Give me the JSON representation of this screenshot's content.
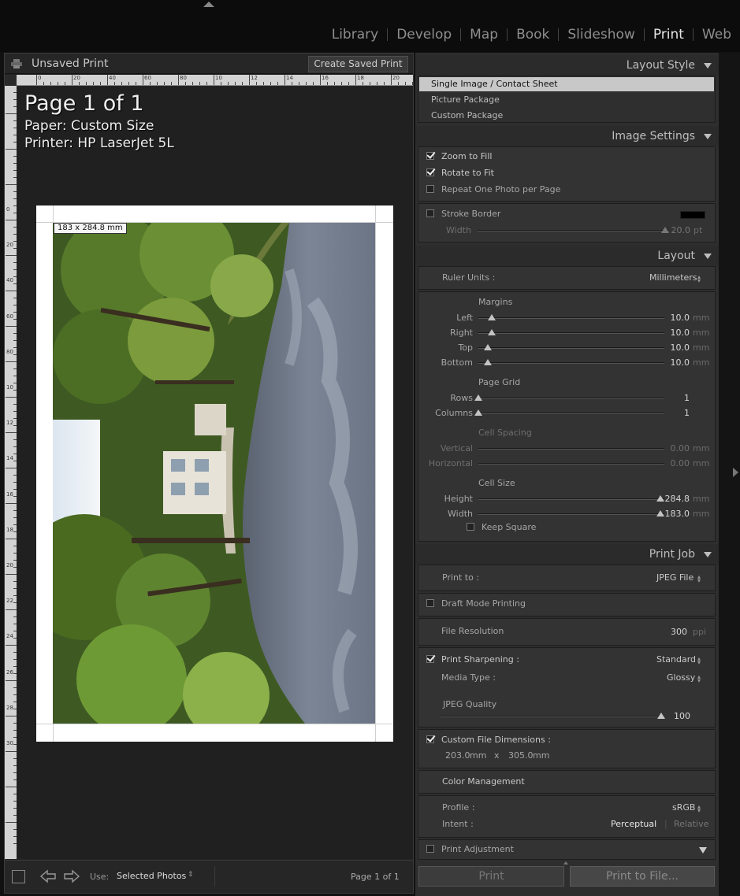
{
  "modules": [
    "Library",
    "Develop",
    "Map",
    "Book",
    "Slideshow",
    "Print",
    "Web"
  ],
  "active_module": "Print",
  "left_header": {
    "title": "Unsaved Print",
    "create_button": "Create Saved Print"
  },
  "page_info": {
    "title": "Page 1 of 1",
    "paper": "Paper:  Custom Size",
    "printer": "Printer:  HP LaserJet 5L"
  },
  "ruler": {
    "h_labels": [
      "0",
      "20",
      "40",
      "60",
      "80",
      "10",
      "12",
      "14",
      "16",
      "18",
      "20"
    ],
    "v_labels": [
      "0",
      "20",
      "40",
      "60",
      "80",
      "10",
      "12",
      "14",
      "16",
      "18",
      "20",
      "22",
      "24",
      "26",
      "28",
      "30"
    ]
  },
  "cell_dimension_label": "183 x 284.8 mm",
  "filmstrip": {
    "use_label": "Use:",
    "use_value": "Selected Photos",
    "page_count": "Page 1 of 1"
  },
  "layout_style": {
    "title": "Layout Style",
    "items": [
      "Single Image / Contact Sheet",
      "Picture Package",
      "Custom Package"
    ],
    "selected": 0
  },
  "image_settings": {
    "title": "Image Settings",
    "zoom_to_fill": "Zoom to Fill",
    "rotate_to_fit": "Rotate to Fit",
    "repeat_one": "Repeat One Photo per Page",
    "stroke_border": "Stroke Border",
    "width_label": "Width",
    "width_value": "20.0",
    "width_unit": "pt",
    "stroke_color": "#000000"
  },
  "layout": {
    "title": "Layout",
    "ruler_units_label": "Ruler Units :",
    "ruler_units_value": "Millimeters",
    "margins_title": "Margins",
    "margins": [
      {
        "label": "Left",
        "value": "10.0",
        "unit": "mm",
        "level": 0.07
      },
      {
        "label": "Right",
        "value": "10.0",
        "unit": "mm",
        "level": 0.07
      },
      {
        "label": "Top",
        "value": "10.0",
        "unit": "mm",
        "level": 0.05
      },
      {
        "label": "Bottom",
        "value": "10.0",
        "unit": "mm",
        "level": 0.05
      }
    ],
    "page_grid_title": "Page Grid",
    "grid": [
      {
        "label": "Rows",
        "value": "1",
        "level": 0.0
      },
      {
        "label": "Columns",
        "value": "1",
        "level": 0.0
      }
    ],
    "cell_spacing_title": "Cell Spacing",
    "spacing": [
      {
        "label": "Vertical",
        "value": "0.00",
        "unit": "mm"
      },
      {
        "label": "Horizontal",
        "value": "0.00",
        "unit": "mm"
      }
    ],
    "cell_size_title": "Cell Size",
    "cell_size": [
      {
        "label": "Height",
        "value": "284.8",
        "unit": "mm",
        "level": 0.98
      },
      {
        "label": "Width",
        "value": "183.0",
        "unit": "mm",
        "level": 0.98
      }
    ],
    "keep_square": "Keep Square"
  },
  "print_job": {
    "title": "Print Job",
    "print_to_label": "Print to :",
    "print_to_value": "JPEG File",
    "draft_mode": "Draft Mode Printing",
    "file_resolution_label": "File Resolution",
    "file_resolution_value": "300",
    "file_resolution_unit": "ppi",
    "sharpening_label": "Print Sharpening :",
    "sharpening_value": "Standard",
    "media_type_label": "Media Type :",
    "media_type_value": "Glossy",
    "jpeg_quality_label": "JPEG Quality",
    "jpeg_quality_value": "100",
    "jpeg_quality_level": 1.0,
    "custom_dims_label": "Custom File Dimensions :",
    "custom_w": "203.0",
    "custom_w_unit": "mm",
    "custom_x": "x",
    "custom_h": "305.0",
    "custom_h_unit": "mm",
    "color_mgmt": "Color Management",
    "profile_label": "Profile :",
    "profile_value": "sRGB",
    "intent_label": "Intent :",
    "intent_perceptual": "Perceptual",
    "intent_sep": "|",
    "intent_relative": "Relative",
    "print_adjustment": "Print Adjustment"
  },
  "buttons": {
    "print": "Print",
    "print_to_file": "Print to File..."
  }
}
